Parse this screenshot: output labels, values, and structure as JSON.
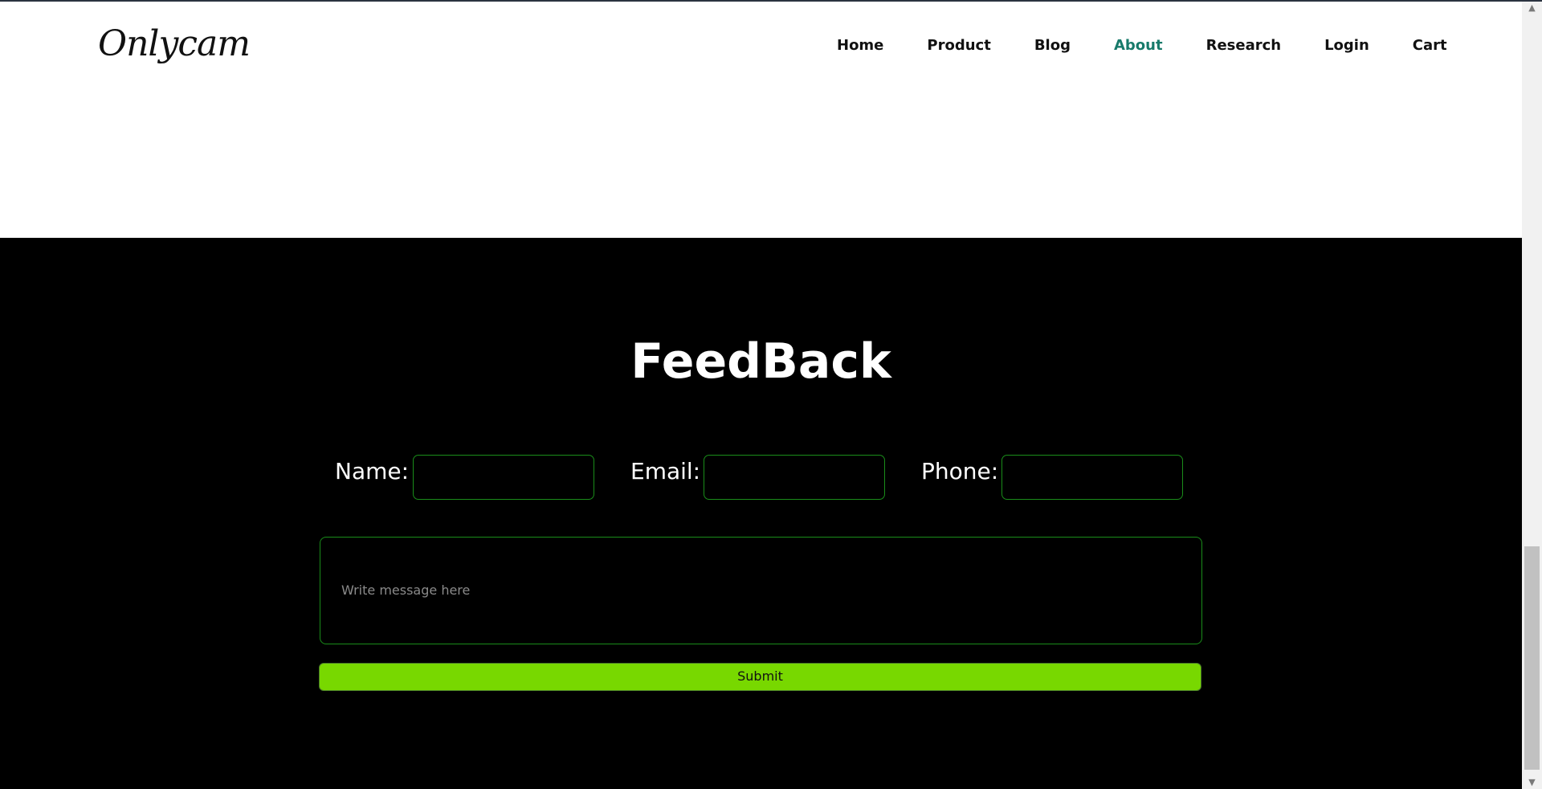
{
  "header": {
    "logo": "Onlycam",
    "nav": [
      {
        "label": "Home",
        "active": false
      },
      {
        "label": "Product",
        "active": false
      },
      {
        "label": "Blog",
        "active": false
      },
      {
        "label": "About",
        "active": true
      },
      {
        "label": "Research",
        "active": false
      },
      {
        "label": "Login",
        "active": false
      },
      {
        "label": "Cart",
        "active": false
      }
    ]
  },
  "feedback": {
    "title": "FeedBack",
    "name_label": "Name:",
    "email_label": "Email:",
    "phone_label": "Phone:",
    "name_value": "",
    "email_value": "",
    "phone_value": "",
    "message_placeholder": "Write message here",
    "submit_label": "Submit"
  },
  "colors": {
    "active_nav": "#177a6a",
    "section_bg": "#000000",
    "input_border": "#1a8d1a",
    "submit_bg": "#78d800"
  },
  "icons": {
    "scroll_up": "triangle-up-icon",
    "scroll_down": "triangle-down-icon"
  }
}
